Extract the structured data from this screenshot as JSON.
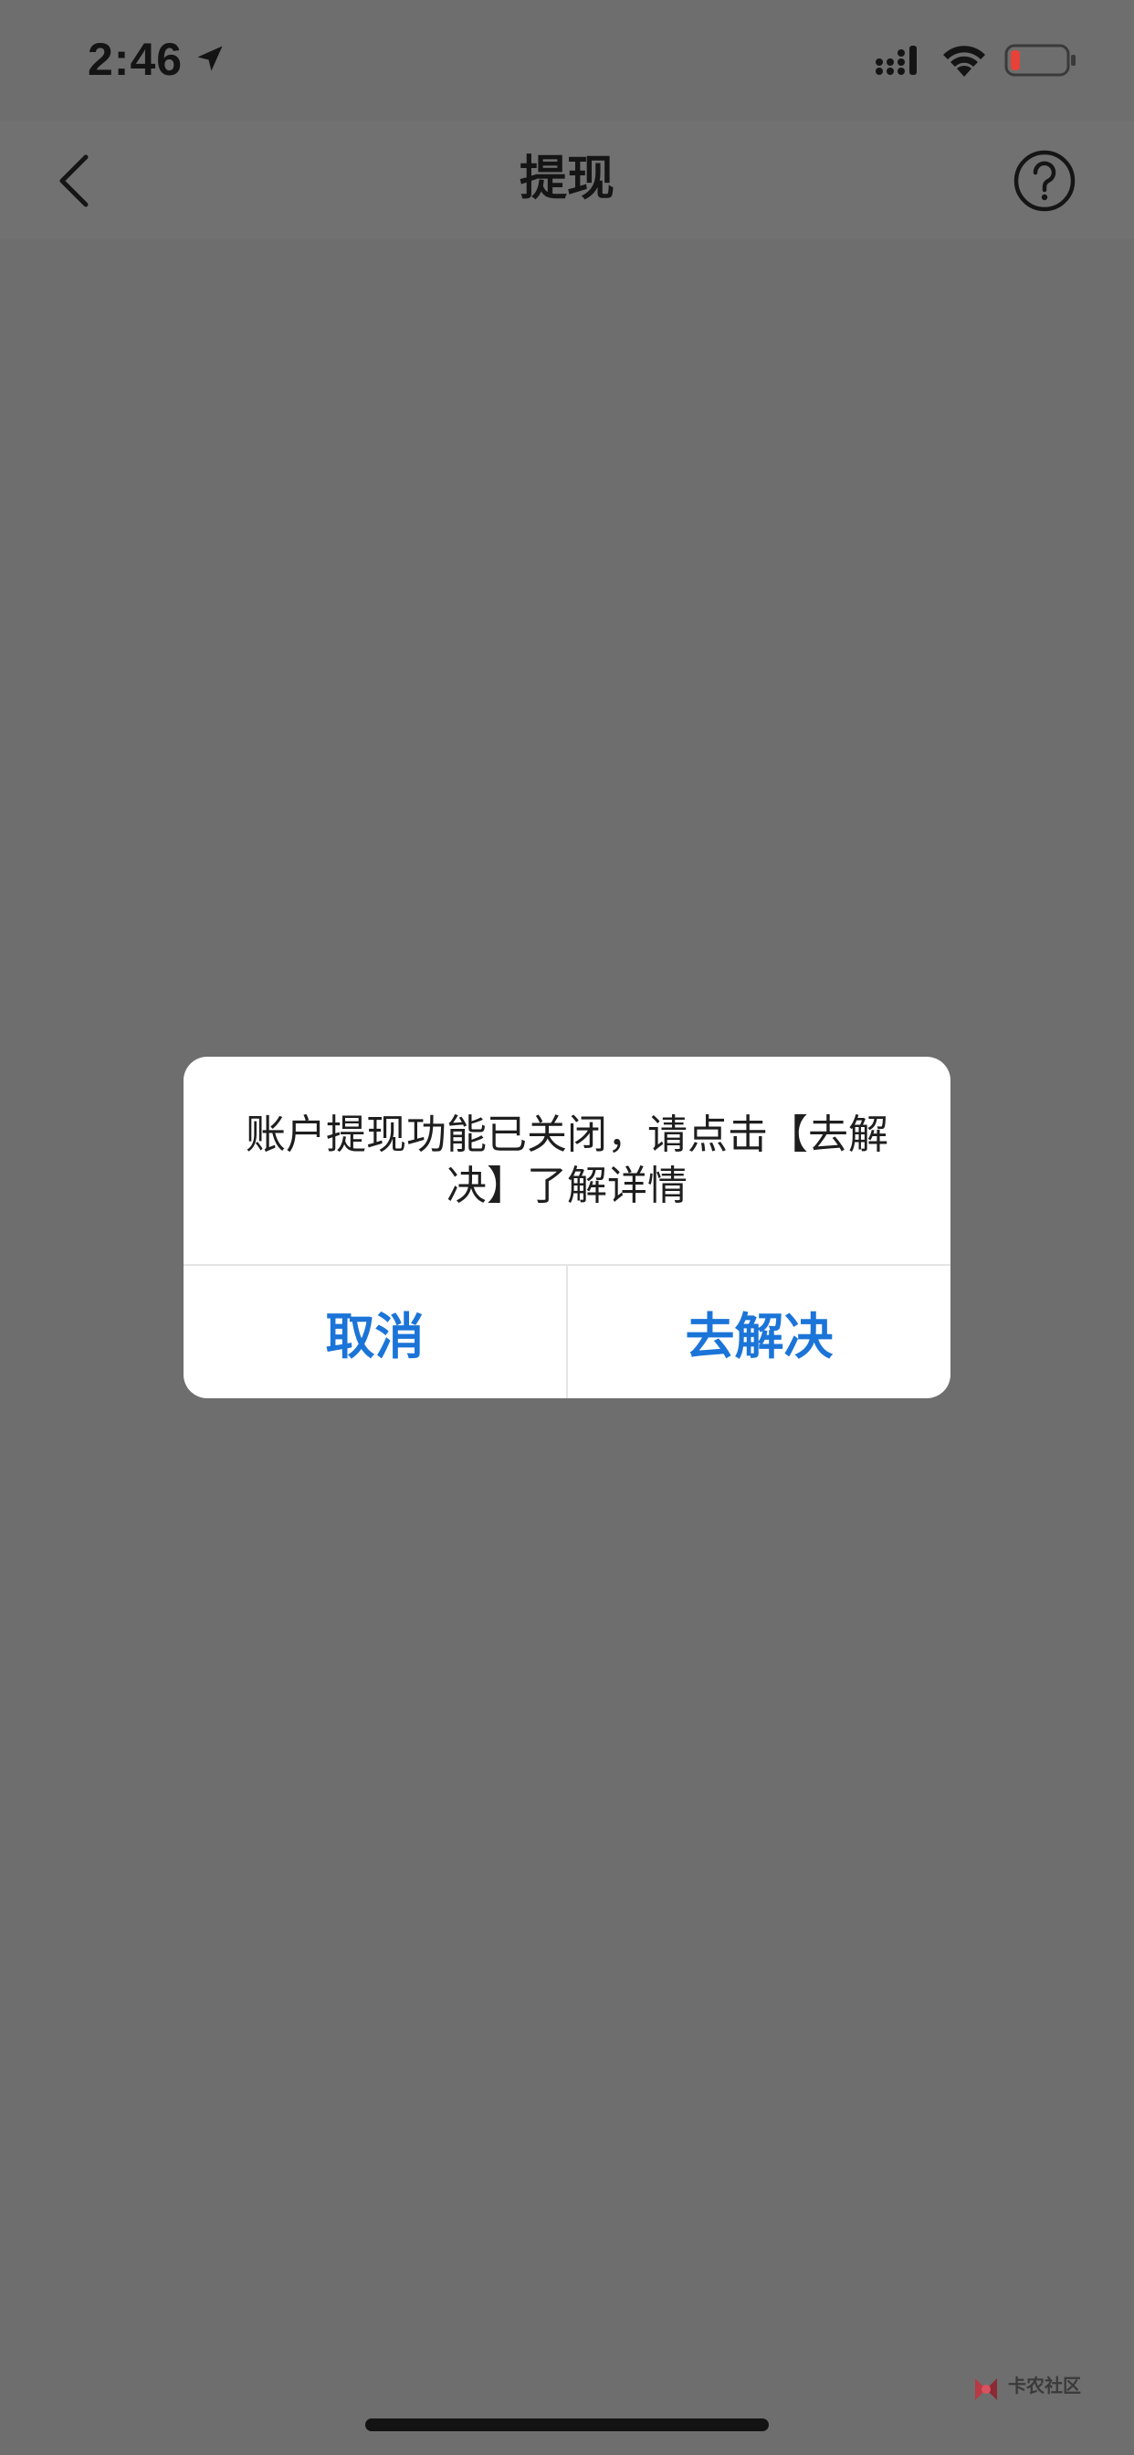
{
  "status_bar": {
    "time": "2:46",
    "icons": [
      "location-arrow-icon",
      "cellular-signal-icon",
      "wifi-icon",
      "battery-low-icon"
    ],
    "battery_color": "#e8413a"
  },
  "nav": {
    "title": "提现",
    "back_icon": "chevron-left-icon",
    "help_icon": "question-circle-icon"
  },
  "dialog": {
    "message": "账户提现功能已关闭，请点击【去解决】了解详情",
    "cancel_label": "取消",
    "resolve_label": "去解决",
    "button_color": "#1b74d8"
  },
  "watermark": {
    "text": "卡农社区"
  },
  "colors": {
    "overlay_background": "#6e6e6e",
    "dialog_background": "#ffffff"
  }
}
